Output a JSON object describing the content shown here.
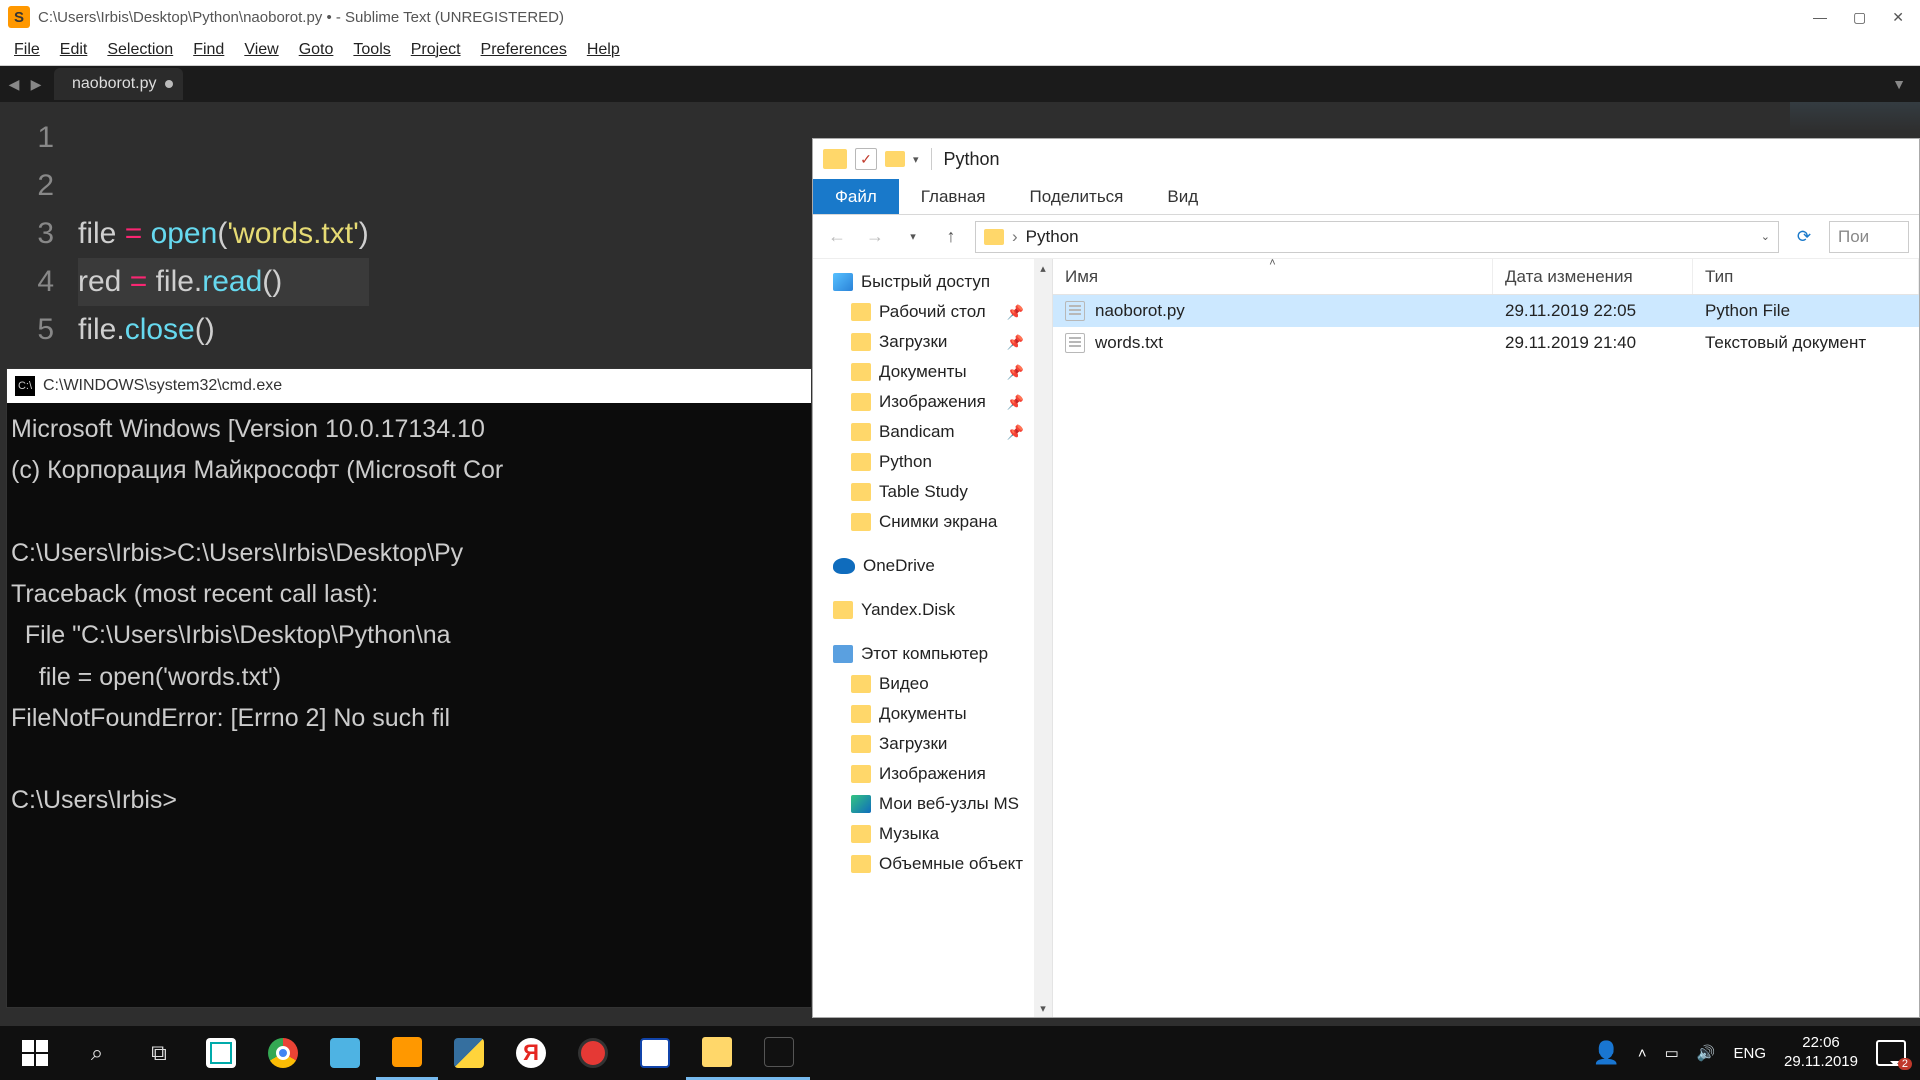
{
  "sublime": {
    "title": "C:\\Users\\Irbis\\Desktop\\Python\\naoborot.py • - Sublime Text (UNREGISTERED)",
    "menu": [
      "File",
      "Edit",
      "Selection",
      "Find",
      "View",
      "Goto",
      "Tools",
      "Project",
      "Preferences",
      "Help"
    ],
    "tab": "naoborot.py",
    "lines": [
      "1",
      "2",
      "3",
      "4",
      "5"
    ],
    "code": {
      "l1": "",
      "l2_var": "file",
      "l2_eq": " = ",
      "l2_fn": "open",
      "l2_par1": "(",
      "l2_str": "'words.txt'",
      "l2_par2": ")",
      "l3_var": "red",
      "l3_eq": " = ",
      "l3_obj": "file.",
      "l3_fn": "read",
      "l3_par": "()",
      "l4_obj": "file.",
      "l4_fn": "close",
      "l4_par": "()"
    }
  },
  "cmd": {
    "title": "C:\\WINDOWS\\system32\\cmd.exe",
    "body": "Microsoft Windows [Version 10.0.17134.10\n(c) Корпорация Майкрософт (Microsoft Cor\n\nC:\\Users\\Irbis>C:\\Users\\Irbis\\Desktop\\Py\nTraceback (most recent call last):\n  File \"C:\\Users\\Irbis\\Desktop\\Python\\na\n    file = open('words.txt')\nFileNotFoundError: [Errno 2] No such fil\n\nC:\\Users\\Irbis>"
  },
  "explorer": {
    "title": "Python",
    "tabs": [
      "Файл",
      "Главная",
      "Поделиться",
      "Вид"
    ],
    "crumb": "Python",
    "search_placeholder": "Пои",
    "columns": {
      "name": "Имя",
      "date": "Дата изменения",
      "type": "Тип"
    },
    "files": [
      {
        "name": "naoborot.py",
        "date": "29.11.2019 22:05",
        "type": "Python File",
        "selected": true
      },
      {
        "name": "words.txt",
        "date": "29.11.2019 21:40",
        "type": "Текстовый документ",
        "selected": false
      }
    ],
    "tree": {
      "quick": "Быстрый доступ",
      "quick_items": [
        {
          "label": "Рабочий стол",
          "pin": true
        },
        {
          "label": "Загрузки",
          "pin": true
        },
        {
          "label": "Документы",
          "pin": true
        },
        {
          "label": "Изображения",
          "pin": true
        },
        {
          "label": "Bandicam",
          "pin": true
        },
        {
          "label": "Python",
          "pin": false
        },
        {
          "label": "Table Study",
          "pin": false
        },
        {
          "label": "Снимки экрана",
          "pin": false
        }
      ],
      "onedrive": "OneDrive",
      "yandex": "Yandex.Disk",
      "pc": "Этот компьютер",
      "pc_items": [
        "Видео",
        "Документы",
        "Загрузки",
        "Изображения",
        "Мои веб-узлы MS",
        "Музыка",
        "Объемные объект"
      ]
    }
  },
  "taskbar": {
    "lang": "ENG",
    "time": "22:06",
    "date": "29.11.2019",
    "notif": "2"
  }
}
